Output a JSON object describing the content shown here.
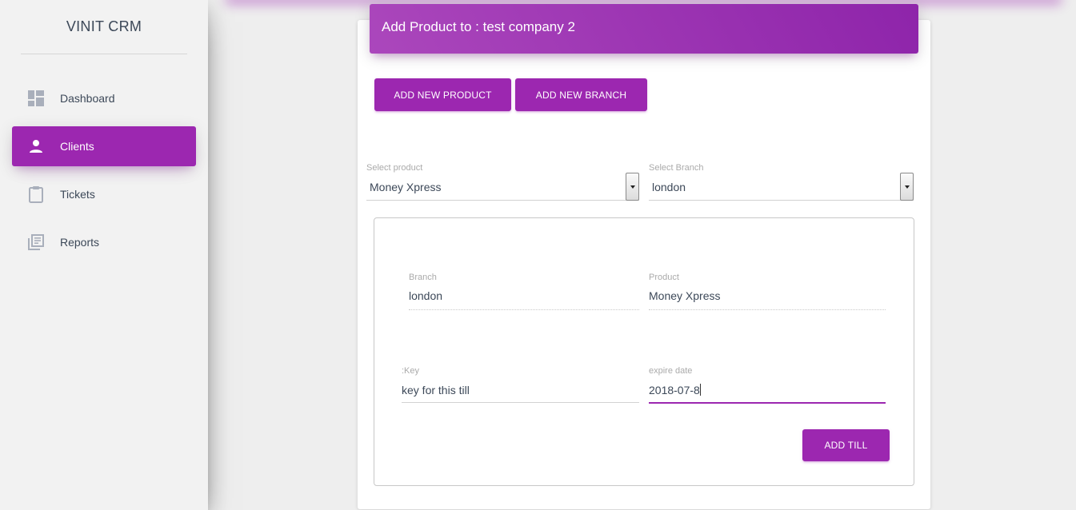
{
  "sidebar": {
    "brand": "VINIT CRM",
    "items": [
      {
        "label": "Dashboard",
        "icon": "dashboard-icon"
      },
      {
        "label": "Clients",
        "icon": "person-icon"
      },
      {
        "label": "Tickets",
        "icon": "clipboard-icon"
      },
      {
        "label": "Reports",
        "icon": "library-books-icon"
      }
    ],
    "active_index": 1
  },
  "card": {
    "title": "Add Product to : test company 2",
    "add_product_label": "ADD NEW PRODUCT",
    "add_branch_label": "ADD NEW BRANCH"
  },
  "selects": {
    "product": {
      "label": "Select product",
      "value": "Money Xpress"
    },
    "branch": {
      "label": "Select Branch",
      "value": "london"
    }
  },
  "form": {
    "branch": {
      "label": "Branch",
      "value": "london"
    },
    "product": {
      "label": "Product",
      "value": "Money Xpress"
    },
    "key": {
      "label": ":Key",
      "value": "key for this till"
    },
    "expire": {
      "label": "expire date",
      "value": "2018-07-8"
    },
    "submit_label": "ADD TILL"
  },
  "colors": {
    "accent": "#9c27b0",
    "header_gradient_start": "#ab47bc",
    "header_gradient_end": "#8e24aa",
    "page_bg": "#eeeeee"
  }
}
